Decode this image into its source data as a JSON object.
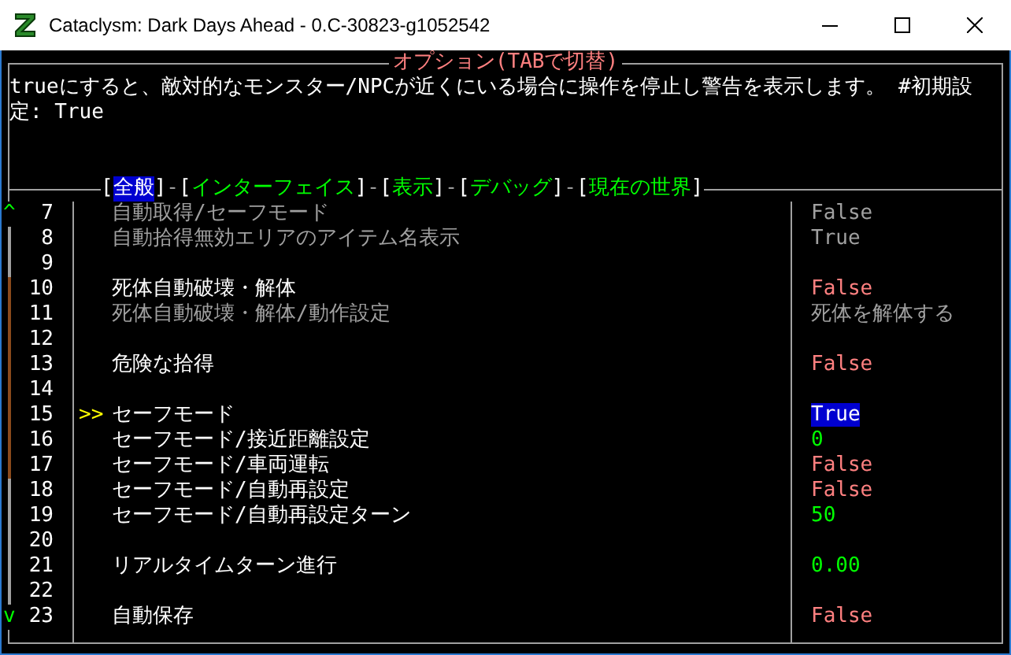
{
  "window": {
    "title": "Cataclysm: Dark Days Ahead - 0.C-30823-g1052542"
  },
  "header": "オプション(TABで切替)",
  "description": "trueにすると、敵対的なモンスター/NPCが近くにいる場合に操作を停止し警告を表示します。 #初期設定: True",
  "tab_brackets": [
    "[",
    "]"
  ],
  "tab_separator": "-",
  "tabs": [
    {
      "label": "全般",
      "selected": true
    },
    {
      "label": "インターフェイス",
      "selected": false
    },
    {
      "label": "表示",
      "selected": false
    },
    {
      "label": "デバッグ",
      "selected": false
    },
    {
      "label": "現在の世界",
      "selected": false
    }
  ],
  "scroll_up": "^",
  "scroll_down": "v",
  "cursor": ">>",
  "rows": [
    {
      "number": "7",
      "label": "自動取得/セーフモード",
      "value": "False",
      "disabled": true,
      "selected": false,
      "color": "#a0a0a0"
    },
    {
      "number": "8",
      "label": "自動拾得無効エリアのアイテム名表示",
      "value": "True",
      "disabled": true,
      "selected": false,
      "color": "#a0a0a0"
    },
    {
      "number": "9"
    },
    {
      "number": "10",
      "label": "死体自動破壊・解体",
      "value": "False",
      "disabled": false,
      "selected": false,
      "color": "#ff8080"
    },
    {
      "number": "11",
      "label": "死体自動破壊・解体/動作設定",
      "value": "死体を解体する",
      "disabled": true,
      "selected": false,
      "color": "#a0a0a0"
    },
    {
      "number": "12"
    },
    {
      "number": "13",
      "label": "危険な拾得",
      "value": "False",
      "disabled": false,
      "selected": false,
      "color": "#ff8080"
    },
    {
      "number": "14"
    },
    {
      "number": "15",
      "label": "セーフモード",
      "value": "True",
      "disabled": false,
      "selected": true
    },
    {
      "number": "16",
      "label": "セーフモード/接近距離設定",
      "value": "0",
      "disabled": false,
      "selected": false,
      "color": "#00ff00"
    },
    {
      "number": "17",
      "label": "セーフモード/車両運転",
      "value": "False",
      "disabled": false,
      "selected": false,
      "color": "#ff8080"
    },
    {
      "number": "18",
      "label": "セーフモード/自動再設定",
      "value": "False",
      "disabled": false,
      "selected": false,
      "color": "#ff8080"
    },
    {
      "number": "19",
      "label": "セーフモード/自動再設定ターン",
      "value": "50",
      "disabled": false,
      "selected": false,
      "color": "#00ff00"
    },
    {
      "number": "20"
    },
    {
      "number": "21",
      "label": "リアルタイムターン進行",
      "value": "0.00",
      "disabled": false,
      "selected": false,
      "color": "#00ff00"
    },
    {
      "number": "22"
    },
    {
      "number": "23",
      "label": "自動保存",
      "value": "False",
      "disabled": false,
      "selected": false,
      "color": "#ff8080"
    }
  ]
}
